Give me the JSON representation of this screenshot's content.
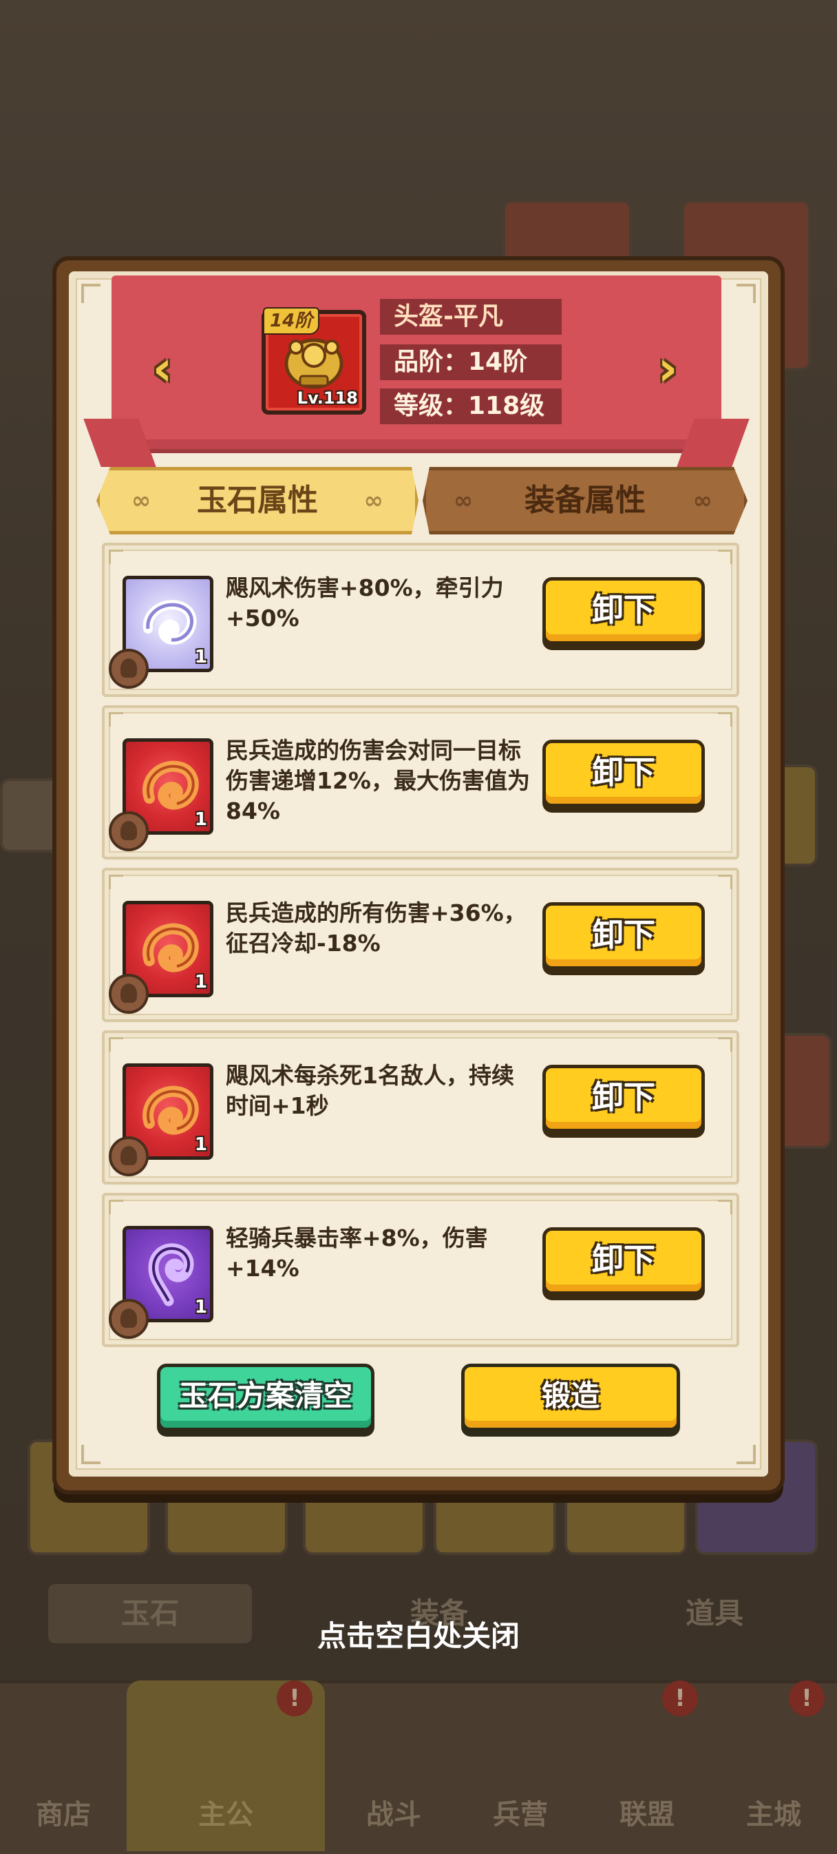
{
  "background": {
    "subtabs": [
      "玉石",
      "装备",
      "道具"
    ],
    "tabs": [
      "商店",
      "主公",
      "战斗",
      "兵营",
      "联盟",
      "主城"
    ],
    "badge": "!"
  },
  "header": {
    "item_tier": "14阶",
    "item_level": "Lv.118",
    "item_name": "头盔-平凡",
    "quality": "品阶：14阶",
    "grade": "等级：118级"
  },
  "tabs": {
    "jade_attr": "玉石属性",
    "equip_attr": "装备属性"
  },
  "jades": [
    {
      "color": "lilac",
      "count": "1",
      "effect": "飓风术伤害+80%，牵引力+50%",
      "button": "卸下"
    },
    {
      "color": "red",
      "count": "1",
      "effect": "民兵造成的伤害会对同一目标伤害递增12%，最大伤害值为84%",
      "button": "卸下"
    },
    {
      "color": "red",
      "count": "1",
      "effect": "民兵造成的所有伤害+36%，征召冷却-18%",
      "button": "卸下"
    },
    {
      "color": "red",
      "count": "1",
      "effect": "飓风术每杀死1名敌人，持续时间+1秒",
      "button": "卸下"
    },
    {
      "color": "purple",
      "count": "1",
      "effect": "轻骑兵暴击率+8%，伤害+14%",
      "button": "卸下"
    }
  ],
  "buttons": {
    "clear_plan": "玉石方案清空",
    "forge": "锻造"
  },
  "close_hint": "点击空白处关闭",
  "colors": {
    "ribbon_red": "#d4515a",
    "button_yellow": "#ffcc1f",
    "button_green": "#3fd49a",
    "paper": "#f4ecd9",
    "frame_brown": "#6b4422"
  }
}
